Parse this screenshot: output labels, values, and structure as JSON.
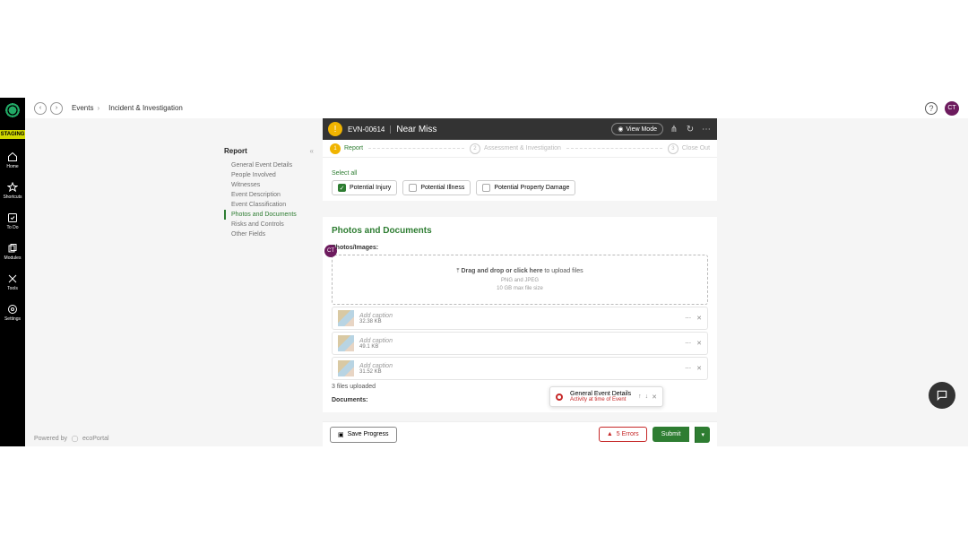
{
  "rail": {
    "badge": "STAGING",
    "items": [
      {
        "label": "Home",
        "icon": "home"
      },
      {
        "label": "Shortcuts",
        "icon": "star"
      },
      {
        "label": "To Do",
        "icon": "check"
      },
      {
        "label": "Modules",
        "icon": "copy"
      },
      {
        "label": "Tools",
        "icon": "cross"
      },
      {
        "label": "Settings",
        "icon": "gear"
      }
    ]
  },
  "topbar": {
    "crumb1": "Events",
    "crumb2": "Incident & Investigation",
    "avatar": "CT"
  },
  "sectionNav": {
    "title": "Report",
    "items": [
      "General Event Details",
      "People Involved",
      "Witnesses",
      "Event Description",
      "Event Classification",
      "Photos and Documents",
      "Risks and Controls",
      "Other Fields"
    ],
    "activeIndex": 5
  },
  "panel": {
    "id": "EVN-00614",
    "title": "Near Miss",
    "viewMode": "View Mode",
    "steps": [
      "Report",
      "Assessment & Investigation",
      "Close Out"
    ]
  },
  "classification": {
    "selectAll": "Select all",
    "options": [
      {
        "label": "Potential Injury",
        "checked": true
      },
      {
        "label": "Potential Illness",
        "checked": false
      },
      {
        "label": "Potential Property Damage",
        "checked": false
      }
    ]
  },
  "photos": {
    "heading": "Photos and Documents",
    "fieldLabel": "Photos/Images:",
    "dropzone": {
      "main": "Drag and drop or click here",
      "tail": " to upload files",
      "hint1": "PNG and JPEG",
      "hint2": "10 GB max file size"
    },
    "files": [
      {
        "caption": "Add caption",
        "size": "32.38 KB"
      },
      {
        "caption": "Add caption",
        "size": "49.1 KB"
      },
      {
        "caption": "Add caption",
        "size": "31.52 KB"
      }
    ],
    "count": "3 files uploaded",
    "documentsLabel": "Documents:"
  },
  "errorPopover": {
    "title": "General Event Details",
    "sub": "Activity at time of Event"
  },
  "footer": {
    "save": "Save Progress",
    "errors": "5 Errors",
    "submit": "Submit"
  },
  "powered": {
    "by": "Powered by",
    "name": "ecoPortal"
  }
}
